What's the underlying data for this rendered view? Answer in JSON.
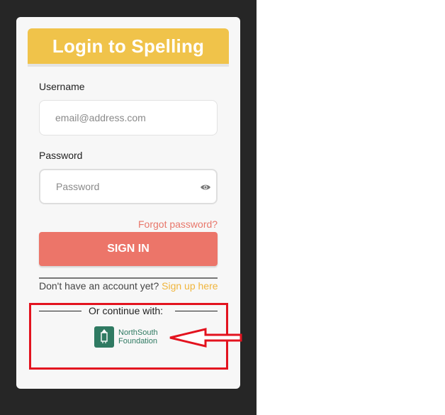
{
  "login": {
    "title": "Login to Spelling",
    "username_label": "Username",
    "username_placeholder": "email@address.com",
    "password_label": "Password",
    "password_placeholder": "Password",
    "forgot_password": "Forgot password?",
    "sign_in_label": "SIGN IN",
    "no_account_text": "Don't have an account yet?",
    "sign_up_link": "Sign up here",
    "continue_with": "Or continue with:",
    "provider": {
      "name_line1": "NorthSouth",
      "name_line2": "Foundation",
      "icon": "northsouth-logo"
    }
  },
  "colors": {
    "title_bar": "#f0c34a",
    "sign_in_button": "#ec7569",
    "forgot_link": "#e8766a",
    "sign_up_link": "#f0b53c",
    "provider_green": "#2f7a62",
    "annotation_red": "#e3131f"
  },
  "icons": {
    "password_toggle": "eye-icon"
  }
}
